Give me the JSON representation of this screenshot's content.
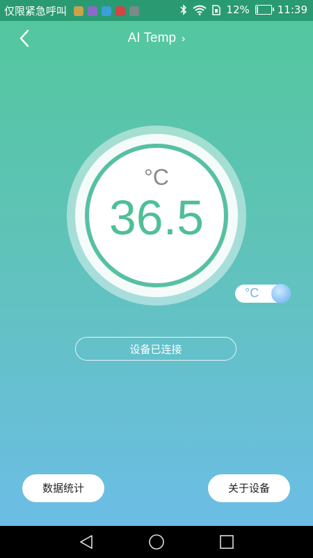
{
  "status_bar": {
    "carrier_text": "仅限紧急呼叫",
    "battery_percent": "12%",
    "battery_level": 0.12,
    "time": "11:39",
    "icons": [
      "bluetooth-icon",
      "wifi-icon",
      "sim-icon",
      "battery-charging-icon"
    ]
  },
  "header": {
    "title": "AI Temp",
    "title_chevron": "›"
  },
  "gauge": {
    "unit": "°C",
    "temperature": "36.5",
    "accent_color": "#4fbf97"
  },
  "toggle": {
    "label": "°C"
  },
  "connection": {
    "status": "设备已连接"
  },
  "buttons": {
    "stats": "数据统计",
    "about": "关于设备"
  }
}
